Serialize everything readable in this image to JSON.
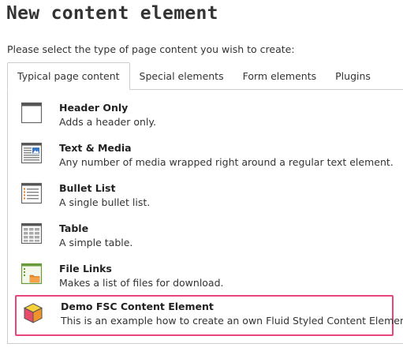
{
  "page_title": "New content element",
  "intro": "Please select the type of page content you wish to create:",
  "tabs": [
    {
      "label": "Typical page content",
      "active": true
    },
    {
      "label": "Special elements",
      "active": false
    },
    {
      "label": "Form elements",
      "active": false
    },
    {
      "label": "Plugins",
      "active": false
    }
  ],
  "items": [
    {
      "title": "Header Only",
      "desc": "Adds a header only.",
      "icon": "header-icon"
    },
    {
      "title": "Text & Media",
      "desc": "Any number of media wrapped right around a regular text element.",
      "icon": "text-media-icon"
    },
    {
      "title": "Bullet List",
      "desc": "A single bullet list.",
      "icon": "bullet-list-icon"
    },
    {
      "title": "Table",
      "desc": "A simple table.",
      "icon": "table-icon"
    },
    {
      "title": "File Links",
      "desc": "Makes a list of files for download.",
      "icon": "file-links-icon"
    },
    {
      "title": "Demo FSC Content Element",
      "desc": "This is an example how to create an own Fluid Styled Content Element",
      "icon": "cube-icon",
      "selected": true
    }
  ],
  "colors": {
    "highlight": "#e8457a",
    "border": "#cccccc",
    "text": "#333333"
  }
}
